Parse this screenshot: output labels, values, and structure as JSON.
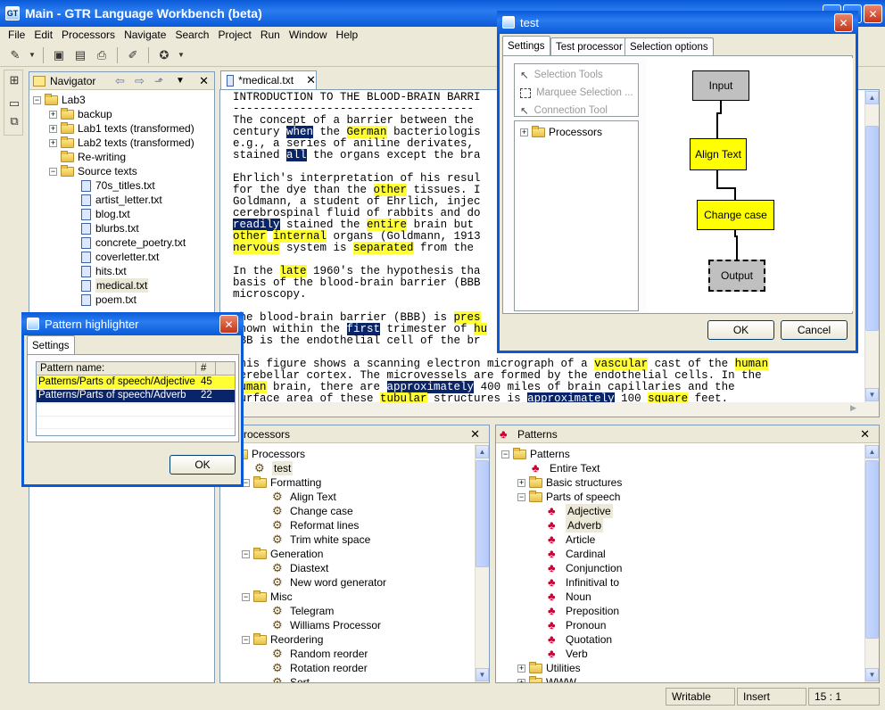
{
  "window": {
    "title": "Main - GTR Language Workbench (beta)"
  },
  "menu": [
    "File",
    "Edit",
    "Processors",
    "Navigate",
    "Search",
    "Project",
    "Run",
    "Window",
    "Help"
  ],
  "navigator": {
    "title": "Navigator",
    "root": "Lab3",
    "items": [
      "backup",
      "Lab1 texts (transformed)",
      "Lab2 texts (transformed)",
      "Re-writing",
      "Source texts"
    ],
    "files": [
      "70s_titles.txt",
      "artist_letter.txt",
      "blog.txt",
      "blurbs.txt",
      "concrete_poetry.txt",
      "coverletter.txt",
      "hits.txt",
      "medical.txt",
      "poem.txt"
    ]
  },
  "editor": {
    "tab": "*medical.txt",
    "heading": "INTRODUCTION TO THE BLOOD-BRAIN BARRI",
    "rule": "------------------------------------"
  },
  "processors_panel": {
    "title": "Processors",
    "root": "Processors",
    "test": "test",
    "groups": {
      "formatting": "Formatting",
      "formatting_items": [
        "Align Text",
        "Change case",
        "Reformat lines",
        "Trim white space"
      ],
      "generation": "Generation",
      "generation_items": [
        "Diastext",
        "New word generator"
      ],
      "misc": "Misc",
      "misc_items": [
        "Telegram",
        "Williams Processor"
      ],
      "reordering": "Reordering",
      "reordering_items": [
        "Random reorder",
        "Rotation reorder",
        "Sort"
      ]
    }
  },
  "patterns_panel": {
    "title": "Patterns",
    "root": "Patterns",
    "entire": "Entire Text",
    "basic": "Basic structures",
    "pos": "Parts of speech",
    "pos_items": [
      "Adjective",
      "Adverb",
      "Article",
      "Cardinal",
      "Conjunction",
      "Infinitival to",
      "Noun",
      "Preposition",
      "Pronoun",
      "Quotation",
      "Verb"
    ],
    "utilities": "Utilities",
    "last": "WWW"
  },
  "test_dialog": {
    "title": "test",
    "tabs": [
      "Settings",
      "Test processor",
      "Selection options"
    ],
    "tools": [
      "Selection Tools",
      "Marquee Selection ...",
      "Connection Tool"
    ],
    "processors": "Processors",
    "nodes": [
      "Input",
      "Align Text",
      "Change case",
      "Output"
    ],
    "ok": "OK",
    "cancel": "Cancel",
    "colors": {
      "input": "#c0c0c0",
      "step": "#ffff00"
    }
  },
  "highlighter": {
    "title": "Pattern highlighter",
    "tab": "Settings",
    "col_name": "Pattern name:",
    "col_count": "#",
    "rows": [
      {
        "name": "Patterns/Parts of speech/Adjective",
        "count": "45"
      },
      {
        "name": "Patterns/Parts of speech/Adverb",
        "count": "22"
      }
    ],
    "ok": "OK"
  },
  "statusbar": {
    "mode": "Writable",
    "insert": "Insert",
    "pos": "15 : 1"
  }
}
